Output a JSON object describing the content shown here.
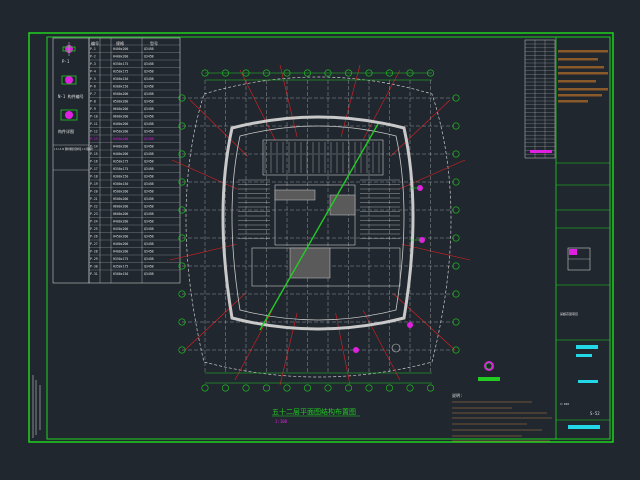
{
  "drawing": {
    "title": "五十二层平面图结构布置图",
    "subtitle": "1:100",
    "note_label": "说明:"
  },
  "legend": {
    "items": [
      {
        "label": "P-1"
      },
      {
        "label": "N-1 构件编号"
      },
      {
        "label": "构件详图"
      },
      {
        "label": "N-1 构件编号"
      }
    ],
    "remark": "1.P-1~P-20 钢构件规格详见构件表 2.N 钢梁编号"
  },
  "schedule": {
    "headers": [
      "编号",
      "规格",
      "型号"
    ],
    "rows": [
      [
        "P-1",
        "H400x200",
        "Q345B"
      ],
      [
        "P-2",
        "H400x200",
        "Q345B"
      ],
      [
        "P-3",
        "H350x175",
        "Q345B"
      ],
      [
        "P-4",
        "H350x175",
        "Q345B"
      ],
      [
        "P-5",
        "H300x150",
        "Q345B"
      ],
      [
        "P-6",
        "H300x150",
        "Q345B"
      ],
      [
        "P-7",
        "H500x200",
        "Q345B"
      ],
      [
        "P-8",
        "H500x200",
        "Q345B"
      ],
      [
        "P-9",
        "H600x200",
        "Q345B"
      ],
      [
        "P-10",
        "H600x200",
        "Q345B"
      ],
      [
        "P-11",
        "H400x200",
        "Q345B"
      ],
      [
        "P-12",
        "H450x200",
        "Q345B"
      ],
      [
        "P-13",
        "H450x200",
        "Q345B"
      ],
      [
        "P-14",
        "H400x200",
        "Q345B"
      ],
      [
        "P-15",
        "H400x200",
        "Q345B"
      ],
      [
        "P-16",
        "H350x175",
        "Q345B"
      ],
      [
        "P-17",
        "H350x175",
        "Q345B"
      ],
      [
        "P-18",
        "H300x150",
        "Q345B"
      ],
      [
        "P-19",
        "H300x150",
        "Q345B"
      ],
      [
        "P-20",
        "H500x200",
        "Q345B"
      ],
      [
        "P-21",
        "H500x200",
        "Q345B"
      ],
      [
        "P-22",
        "H600x200",
        "Q345B"
      ],
      [
        "P-23",
        "H600x200",
        "Q345B"
      ],
      [
        "P-24",
        "H400x200",
        "Q345B"
      ],
      [
        "P-25",
        "H450x200",
        "Q345B"
      ],
      [
        "P-26",
        "H450x200",
        "Q345B"
      ],
      [
        "P-27",
        "H400x200",
        "Q345B"
      ],
      [
        "P-28",
        "H400x200",
        "Q345B"
      ],
      [
        "P-29",
        "H350x175",
        "Q345B"
      ],
      [
        "P-30",
        "H350x175",
        "Q345B"
      ],
      [
        "P-31",
        "H300x150",
        "Q345B"
      ]
    ]
  },
  "title_block": {
    "scale_label": "1:100",
    "project": "某超高层项目",
    "sheet": "S-52"
  },
  "colors": {
    "background": "#20272f",
    "frame": "#1fd21f",
    "walls": "#c9c9c9",
    "grid_red": "#e02020",
    "grid_green": "#22cc22",
    "magenta": "#e020e0",
    "cyan": "#22d8e8",
    "brown": "#8a5a2a",
    "text": "#e0e0e0"
  }
}
